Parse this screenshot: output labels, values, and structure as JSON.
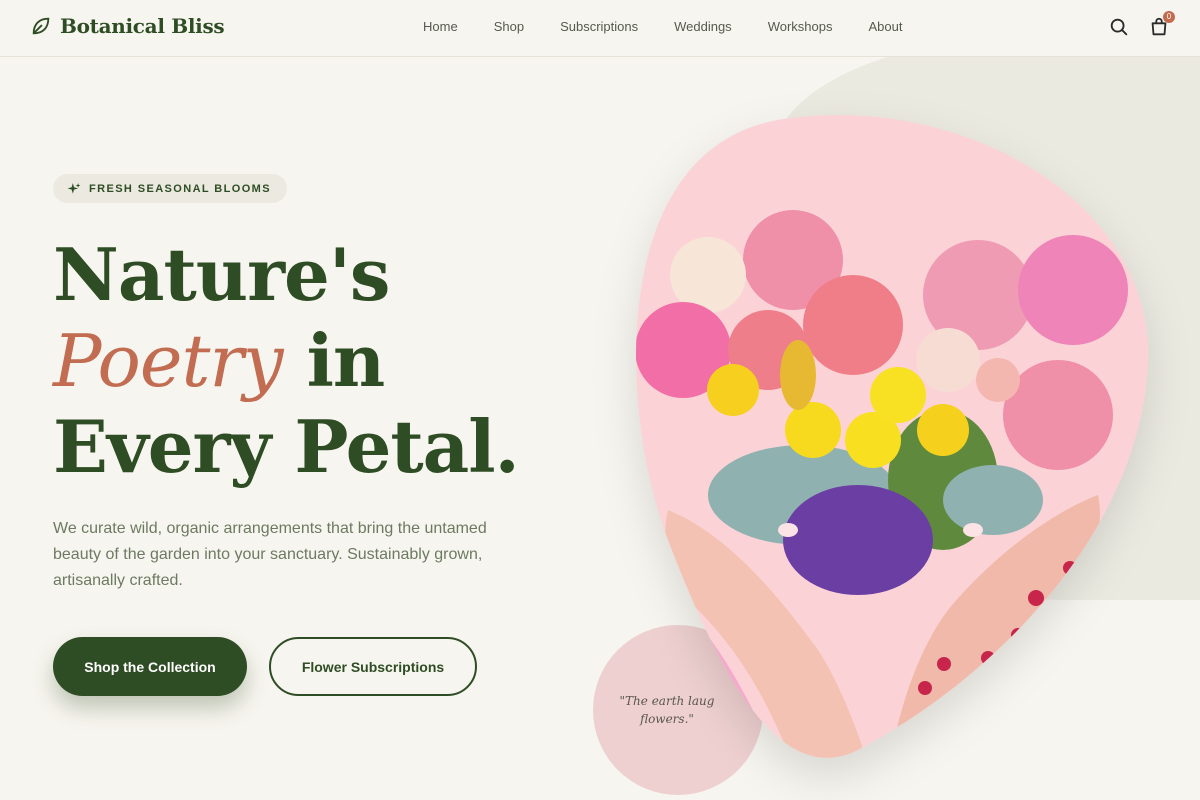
{
  "brand": {
    "name": "Botanical Bliss"
  },
  "nav": {
    "links": [
      "Home",
      "Shop",
      "Subscriptions",
      "Weddings",
      "Workshops",
      "About"
    ],
    "cart_count": "0"
  },
  "hero": {
    "badge": "FRESH SEASONAL BLOOMS",
    "headline_line1": "Nature's",
    "headline_accent": "Poetry",
    "headline_line2_rest": " in",
    "headline_line3": "Every Petal.",
    "description": "We curate wild, organic arrangements that bring the untamed beauty of the garden into your sanctuary. Sustainably grown, artisanally crafted.",
    "primary_cta": "Shop the Collection",
    "secondary_cta": "Flower Subscriptions",
    "quote_line1": "\"The earth laug",
    "quote_line2": "flowers.\""
  },
  "colors": {
    "brand_green": "#2f4d24",
    "accent_terracotta": "#c26c52",
    "background": "#f7f5ef",
    "blob_pink": "#fbd3d7"
  },
  "icons": [
    "leaf-icon",
    "sparkle-icon",
    "search-icon",
    "shopping-bag-icon"
  ]
}
